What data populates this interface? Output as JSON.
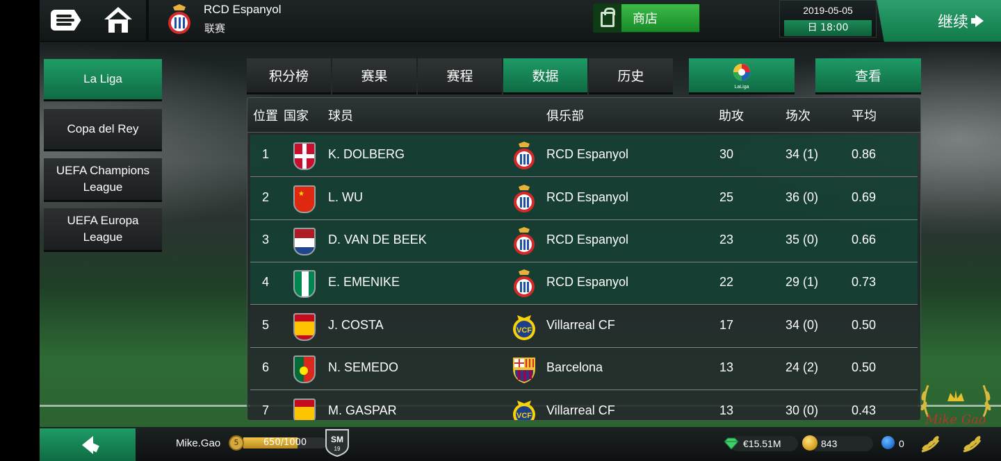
{
  "header": {
    "club_name": "RCD Espanyol",
    "subtitle": "联赛",
    "shop_label": "商店",
    "date": "2019-05-05",
    "time": "日 18:00",
    "continue_label": "继续"
  },
  "sidebar": {
    "items": [
      {
        "label": "La Liga",
        "active": true
      },
      {
        "label": "Copa del Rey",
        "active": false
      },
      {
        "label": "UEFA Champions League",
        "active": false
      },
      {
        "label": "UEFA Europa League",
        "active": false
      }
    ]
  },
  "tabs": [
    {
      "label": "积分榜",
      "active": false
    },
    {
      "label": "赛果",
      "active": false
    },
    {
      "label": "赛程",
      "active": false
    },
    {
      "label": "数据",
      "active": true
    },
    {
      "label": "历史",
      "active": false
    }
  ],
  "league_logo_text": "LaLiga",
  "view_label": "查看",
  "table": {
    "headers": {
      "pos": "位置",
      "nation": "国家",
      "player": "球员",
      "club": "俱乐部",
      "assists": "助攻",
      "apps": "场次",
      "avg": "平均"
    },
    "rows": [
      {
        "pos": "1",
        "player": "K. DOLBERG",
        "club": "RCD Espanyol",
        "assists": "30",
        "apps": "34 (1)",
        "avg": "0.86"
      },
      {
        "pos": "2",
        "player": "L. WU",
        "club": "RCD Espanyol",
        "assists": "25",
        "apps": "36 (0)",
        "avg": "0.69"
      },
      {
        "pos": "3",
        "player": "D. VAN DE BEEK",
        "club": "RCD Espanyol",
        "assists": "23",
        "apps": "35 (0)",
        "avg": "0.66"
      },
      {
        "pos": "4",
        "player": "E. EMENIKE",
        "club": "RCD Espanyol",
        "assists": "22",
        "apps": "29 (1)",
        "avg": "0.73"
      },
      {
        "pos": "5",
        "player": "J. COSTA",
        "club": "Villarreal CF",
        "assists": "17",
        "apps": "34 (0)",
        "avg": "0.50"
      },
      {
        "pos": "6",
        "player": "N. SEMEDO",
        "club": "Barcelona",
        "assists": "13",
        "apps": "24 (2)",
        "avg": "0.50"
      },
      {
        "pos": "7",
        "player": "M. GASPAR",
        "club": "Villarreal CF",
        "assists": "13",
        "apps": "30 (0)",
        "avg": "0.43"
      }
    ]
  },
  "footer": {
    "user_name": "Mike.Gao",
    "level": "5",
    "xp_text": "650/1000",
    "xp_fraction": 0.65,
    "sm_badge": "SM",
    "sm_year": "19",
    "money": "€15.51M",
    "coins": "843",
    "gems": "0"
  },
  "watermark_text": "Mike Gao",
  "colors": {
    "accent_green": "#1e9b66",
    "shop_green": "#3cba48",
    "highlight_row": "#144637"
  }
}
